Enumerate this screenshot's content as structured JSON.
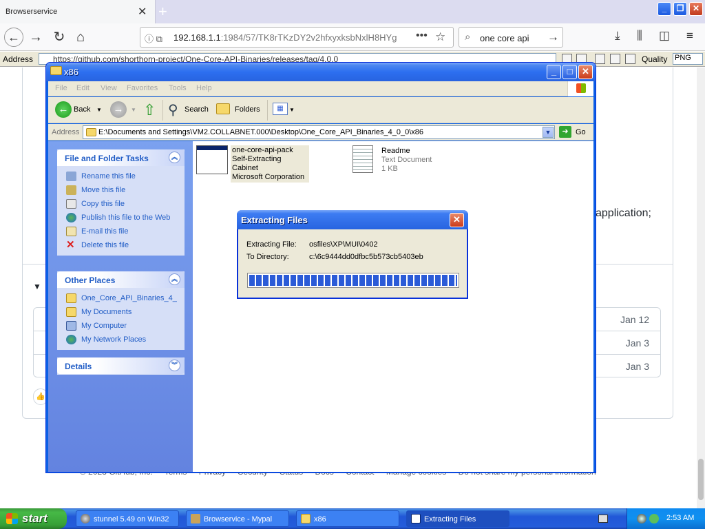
{
  "browser": {
    "tab_title": "Browserservice",
    "tab_close": "✕",
    "new_tab": "+",
    "url_host": "192.168.1.1",
    "url_rest": ":1984/57/TK8rTKzDY2v2hfxyxksbNxlH8HYg",
    "url_actions": "•••",
    "search_query": "one core api",
    "address_label": "Address",
    "address_value": "https://github.com/shorthorn-project/One-Core-API-Binaries/releases/tag/4.0.0",
    "quality_label": "Quality",
    "quality_value": "PNG"
  },
  "webpage": {
    "text_fragment": "application;",
    "asset_dates": [
      "Jan 12",
      "Jan 3",
      "Jan 3"
    ],
    "footer": [
      "© 2023 GitHub, Inc.",
      "Terms",
      "Privacy",
      "Security",
      "Status",
      "Docs",
      "Contact",
      "Manage cookies",
      "Do not share my personal information"
    ]
  },
  "explorer": {
    "title": "x86",
    "menu": [
      "File",
      "Edit",
      "View",
      "Favorites",
      "Tools",
      "Help"
    ],
    "toolbar": {
      "back": "Back",
      "search": "Search",
      "folders": "Folders"
    },
    "address_label": "Address",
    "address_path": "E:\\Documents and Settings\\VM2.COLLABNET.000\\Desktop\\One_Core_API_Binaries_4_0_0\\x86",
    "go_label": "Go",
    "tasks_panel": {
      "title": "File and Folder Tasks",
      "items": [
        "Rename this file",
        "Move this file",
        "Copy this file",
        "Publish this file to the Web",
        "E-mail this file",
        "Delete this file"
      ]
    },
    "places_panel": {
      "title": "Other Places",
      "items": [
        "One_Core_API_Binaries_4_",
        "My Documents",
        "My Computer",
        "My Network Places"
      ]
    },
    "details_panel": {
      "title": "Details"
    },
    "files": [
      {
        "name": "one-core-api-pack",
        "type": "Self-Extracting Cabinet",
        "info": "Microsoft Corporation"
      },
      {
        "name": "Readme",
        "type": "Text Document",
        "info": "1 KB"
      }
    ]
  },
  "extract_dialog": {
    "title": "Extracting Files",
    "file_label": "Extracting File:",
    "file_value": "osfiles\\XP\\MUI\\0402",
    "dir_label": "To Directory:",
    "dir_value": "c:\\6c9444dd0dfbc5b573cb5403eb",
    "progress": 1.0
  },
  "taskbar": {
    "start": "start",
    "tasks": [
      "stunnel 5.49 on Win32",
      "Browservice - Mypal",
      "x86",
      "Extracting Files"
    ],
    "clock": "2:53 AM"
  }
}
